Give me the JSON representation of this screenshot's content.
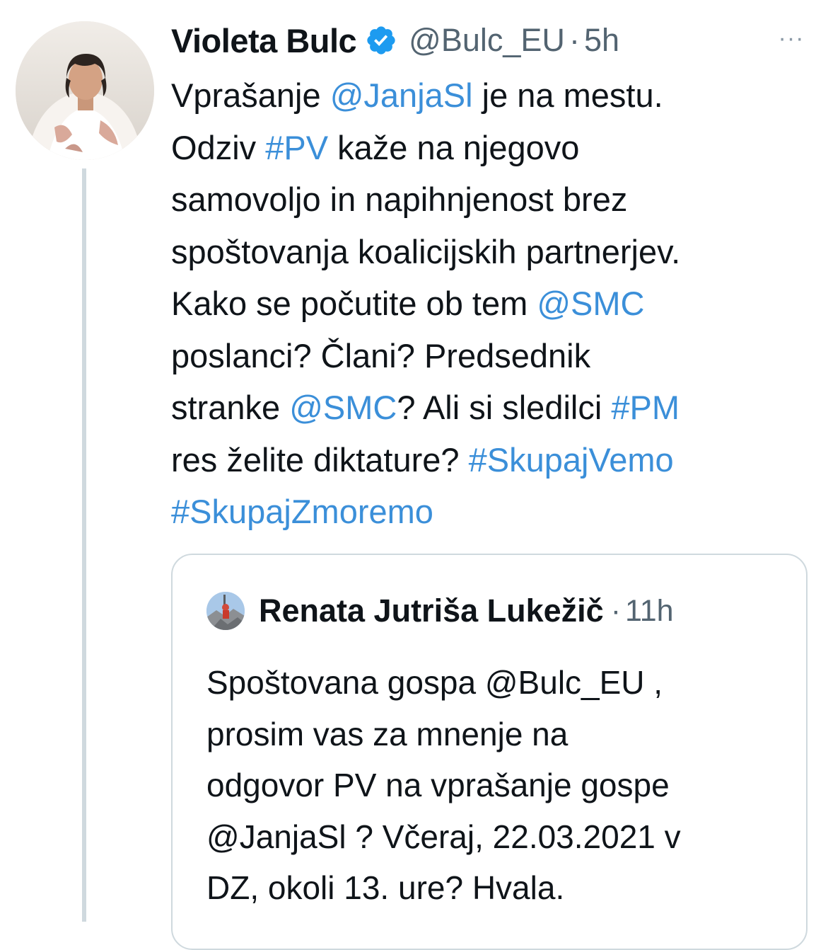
{
  "tweet": {
    "author": {
      "display_name": "Violeta Bulc",
      "handle": "@Bulc_EU",
      "verified": true,
      "avatar_icon": "profile-photo"
    },
    "separator": "·",
    "time": "5h",
    "more_label": "···",
    "text_lines": [
      [
        {
          "t": "Vprašanje ",
          "link": false
        },
        {
          "t": "@JanjaSl",
          "link": true
        },
        {
          "t": " je na mestu.",
          "link": false
        }
      ],
      [
        {
          "t": "Odziv ",
          "link": false
        },
        {
          "t": "#PV",
          "link": true
        },
        {
          "t": " kaže na njegovo",
          "link": false
        }
      ],
      [
        {
          "t": "samovoljo in napihnjenost brez",
          "link": false
        }
      ],
      [
        {
          "t": "spoštovanja koalicijskih partnerjev.",
          "link": false
        }
      ],
      [
        {
          "t": "Kako se počutite ob tem ",
          "link": false
        },
        {
          "t": "@SMC",
          "link": true
        }
      ],
      [
        {
          "t": "poslanci? Člani? Predsednik",
          "link": false
        }
      ],
      [
        {
          "t": "stranke ",
          "link": false
        },
        {
          "t": "@SMC",
          "link": true
        },
        {
          "t": "?  Ali si sledilci ",
          "link": false
        },
        {
          "t": "#PM",
          "link": true
        }
      ],
      [
        {
          "t": "res želite diktature? ",
          "link": false
        },
        {
          "t": "#SkupajVemo",
          "link": true
        }
      ],
      [
        {
          "t": "#SkupajZmoremo",
          "link": true
        }
      ]
    ]
  },
  "quoted_tweet": {
    "author": {
      "display_name": "Renata Jutriša Lukežič",
      "avatar_icon": "profile-photo-small"
    },
    "separator": "·",
    "time": "11h",
    "text_lines": [
      "Spoštovana gospa @Bulc_EU ,",
      "prosim vas za mnenje na",
      "odgovor PV na vprašanje gospe",
      "@JanjaSl ? Včeraj, 22.03.2021 v",
      "DZ, okoli 13. ure? Hvala."
    ]
  },
  "colors": {
    "link": "#3b8fd9",
    "verified": "#1d9bf0",
    "secondary_text": "#536471",
    "thread_line": "#cfd9de"
  }
}
